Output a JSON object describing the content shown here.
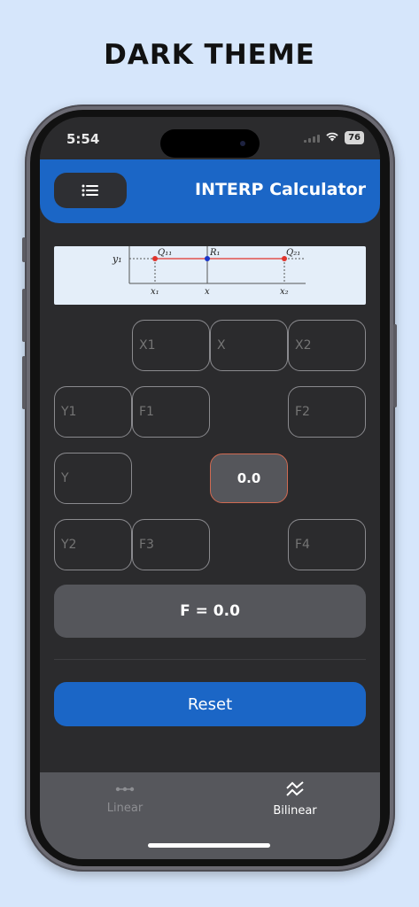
{
  "headline": "DARK THEME",
  "status": {
    "time": "5:54",
    "battery": "76"
  },
  "appbar": {
    "title": "INTERP Calculator",
    "menu_icon": "menu-icon"
  },
  "diagram": {
    "y_label": "y₁",
    "q11_label": "Q₁₁",
    "r1_label": "R₁",
    "q21_label": "Q₂₁",
    "x1_label": "x₁",
    "x_label": "x",
    "x2_label": "x₂"
  },
  "fields": {
    "x1": {
      "placeholder": "X1"
    },
    "x": {
      "placeholder": "X"
    },
    "x2": {
      "placeholder": "X2"
    },
    "y1": {
      "placeholder": "Y1"
    },
    "f1": {
      "placeholder": "F1"
    },
    "f2": {
      "placeholder": "F2"
    },
    "y": {
      "placeholder": "Y"
    },
    "y2": {
      "placeholder": "Y2"
    },
    "f3": {
      "placeholder": "F3"
    },
    "f4": {
      "placeholder": "F4"
    }
  },
  "result_cell": "0.0",
  "f_result": "F = 0.0",
  "reset_label": "Reset",
  "tabs": [
    {
      "label": "Linear",
      "icon": "linear-icon",
      "active": false
    },
    {
      "label": "Bilinear",
      "icon": "bilinear-icon",
      "active": true
    }
  ],
  "colors": {
    "accent": "#1b66c6",
    "background": "#2b2b2d",
    "page_background": "#d6e6fb",
    "point_red": "#e0332b",
    "point_blue": "#1a35c9"
  }
}
